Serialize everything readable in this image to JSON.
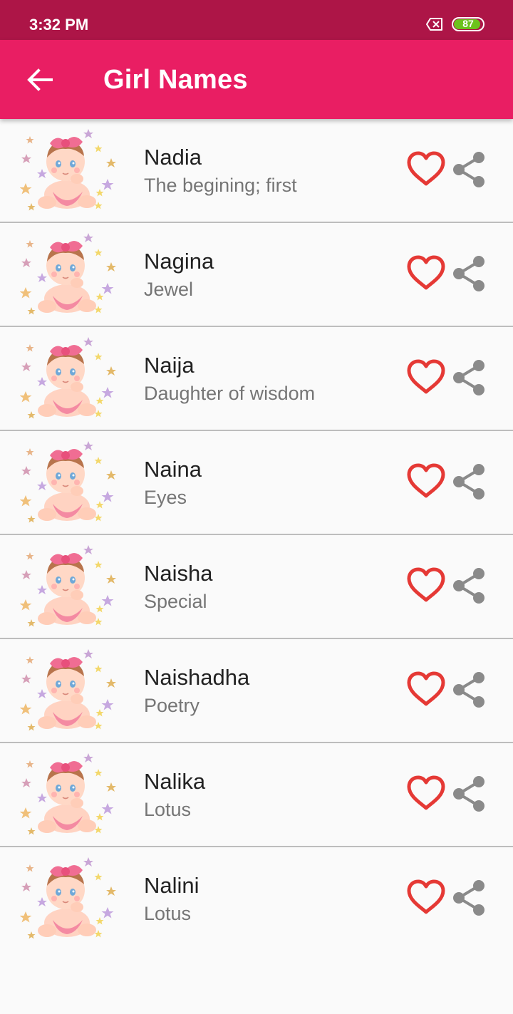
{
  "status_bar": {
    "time": "3:32 PM",
    "battery": "87",
    "battery_level": 0.87,
    "notification_icon": "close-box-icon"
  },
  "app_bar": {
    "back_icon": "arrow-back-icon",
    "title": "Girl Names",
    "color": "#e91e63",
    "status_color": "#ad1547"
  },
  "colors": {
    "favorite": "#e53935",
    "share": "#8a8a8a"
  },
  "names": [
    {
      "name": "Nadia",
      "meaning": "The begining; first"
    },
    {
      "name": "Nagina",
      "meaning": "Jewel"
    },
    {
      "name": "Naija",
      "meaning": "Daughter of wisdom"
    },
    {
      "name": "Naina",
      "meaning": "Eyes"
    },
    {
      "name": "Naisha",
      "meaning": "Special"
    },
    {
      "name": "Naishadha",
      "meaning": "Poetry"
    },
    {
      "name": "Nalika",
      "meaning": "Lotus"
    },
    {
      "name": "Nalini",
      "meaning": "Lotus"
    }
  ]
}
